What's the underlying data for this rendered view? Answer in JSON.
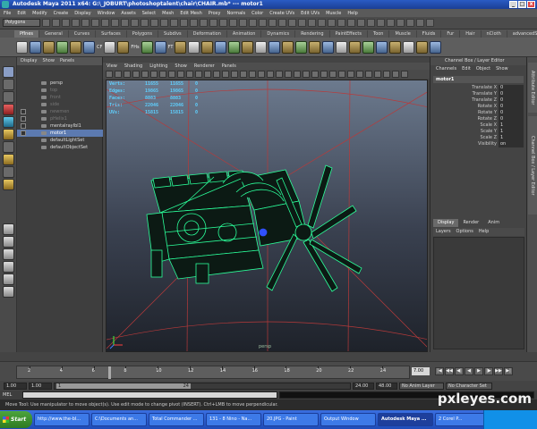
{
  "window": {
    "title": "Autodesk Maya 2011 x64: G:\\_JOBURT\\photoshoptalent\\chair\\CHAIR.mb*   ---   motor1",
    "min": "_",
    "max": "□",
    "close": "x"
  },
  "menus": [
    "File",
    "Edit",
    "Modify",
    "Create",
    "Display",
    "Window",
    "Assets",
    "Select",
    "Mesh",
    "Edit Mesh",
    "Proxy",
    "Normals",
    "Color",
    "Create UVs",
    "Edit UVs",
    "Muscle",
    "Help"
  ],
  "status_mode": "Polygons",
  "shelf_tabs": [
    "Pflnes",
    "General",
    "Curves",
    "Surfaces",
    "Polygons",
    "Subdivs",
    "Deformation",
    "Animation",
    "Dynamics",
    "Rendering",
    "PaintEffects",
    "Toon",
    "Muscle",
    "Fluids",
    "Fur",
    "Hair",
    "nCloth",
    "advancedSkeleton"
  ],
  "shelf_active_tab": "Pflnes",
  "shelf_labels": [
    "CF",
    "FHs",
    "FT"
  ],
  "outliner": {
    "menu": [
      "Display",
      "Show",
      "Panels"
    ],
    "items": [
      {
        "label": "persp",
        "dim": false
      },
      {
        "label": "top",
        "dim": true
      },
      {
        "label": "front",
        "dim": true
      },
      {
        "label": "side",
        "dim": true
      },
      {
        "label": "newmen",
        "dim": true
      },
      {
        "label": "pHelix1",
        "dim": true
      },
      {
        "label": "mentalrayIbl1",
        "dim": false
      },
      {
        "label": "motor1",
        "dim": false,
        "selected": true
      },
      {
        "label": "defaultLightSet",
        "dim": false
      },
      {
        "label": "defaultObjectSet",
        "dim": false
      }
    ]
  },
  "panel_menu": [
    "View",
    "Shading",
    "Lighting",
    "Show",
    "Renderer",
    "Panels"
  ],
  "hud": {
    "rows": [
      {
        "key": "Verts:",
        "a": "11655",
        "b": "11655",
        "c": "0"
      },
      {
        "key": "Edges:",
        "a": "19865",
        "b": "19865",
        "c": "0"
      },
      {
        "key": "Faces:",
        "a": "8883",
        "b": "8883",
        "c": "0"
      },
      {
        "key": "Tris:",
        "a": "22046",
        "b": "22046",
        "c": "0"
      },
      {
        "key": "UVs:",
        "a": "15815",
        "b": "15815",
        "c": "0"
      }
    ]
  },
  "viewport_label": "persp",
  "channel_box": {
    "title": "Channel Box / Layer Editor",
    "menu": [
      "Channels",
      "Edit",
      "Object",
      "Show"
    ],
    "object": "motor1",
    "attrs": [
      {
        "name": "Translate X",
        "value": "0"
      },
      {
        "name": "Translate Y",
        "value": "0"
      },
      {
        "name": "Translate Z",
        "value": "0"
      },
      {
        "name": "Rotate X",
        "value": "0"
      },
      {
        "name": "Rotate Y",
        "value": "0"
      },
      {
        "name": "Rotate Z",
        "value": "0"
      },
      {
        "name": "Scale X",
        "value": "1"
      },
      {
        "name": "Scale Y",
        "value": "1"
      },
      {
        "name": "Scale Z",
        "value": "1"
      },
      {
        "name": "Visibility",
        "value": "on"
      }
    ],
    "layer_tabs": [
      "Display",
      "Render",
      "Anim"
    ],
    "layer_menu": [
      "Layers",
      "Options",
      "Help"
    ]
  },
  "side_tabs": [
    "Attribute Editor",
    "Channel Box / Layer Editor"
  ],
  "timeline": {
    "ticks": [
      "2",
      "4",
      "6",
      "8",
      "10",
      "12",
      "14",
      "16",
      "18",
      "20",
      "22",
      "24"
    ],
    "current_frame": "7.00",
    "play_buttons": [
      "|◀",
      "◀◀",
      "◀|",
      "◀",
      "▶",
      "|▶",
      "▶▶",
      "▶|"
    ]
  },
  "range": {
    "start": "1.00",
    "start2": "1.00",
    "range_start_label": "1",
    "range_end_label": "24",
    "end": "24.00",
    "end2": "48.00",
    "anim_layer": "No Anim Layer",
    "char_set": "No Character Set"
  },
  "cmd_label": "MEL",
  "helpline": "Move Tool: Use manipulator to move object(s). Use edit mode to change pivot (INSERT). Ctrl+LMB to move perpendicular.",
  "watermark": "pxleyes.com",
  "taskbar": {
    "start": "Start",
    "tasks": [
      {
        "label": "http://www.the-bl...",
        "active": false
      },
      {
        "label": "C:\\Documents an...",
        "active": false
      },
      {
        "label": "Total Commander ...",
        "active": false
      },
      {
        "label": "131 - 8 Nino - Na...",
        "active": false
      },
      {
        "label": "20.JPG - Paint",
        "active": false
      },
      {
        "label": "Output Window",
        "active": false
      },
      {
        "label": "Autodesk Maya ...",
        "active": true
      },
      {
        "label": "2 Corel P...",
        "active": false
      }
    ]
  },
  "colors": {
    "wire": "#2bff9a",
    "grid": "#b83a3a",
    "hud": "#5fd0ff"
  }
}
